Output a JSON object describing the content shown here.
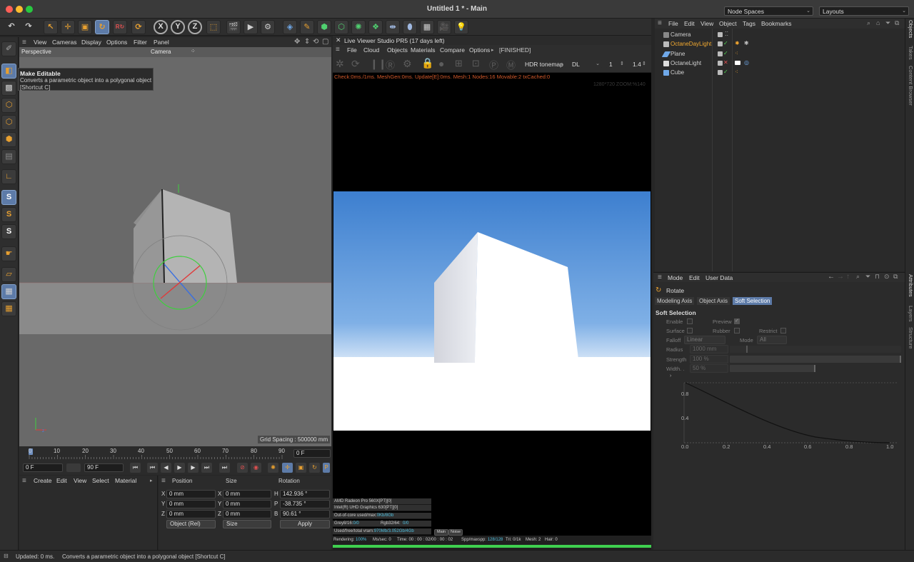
{
  "window": {
    "title": "Untitled 1 * - Main",
    "node_spaces": "Node Spaces",
    "layouts": "Layouts"
  },
  "viewport": {
    "menu": [
      "View",
      "Cameras",
      "Display",
      "Options",
      "Filter",
      "Panel"
    ],
    "projection": "Perspective",
    "camera": "Camera",
    "grid_spacing": "Grid Spacing : 500000 mm"
  },
  "tooltip": {
    "title": "Make Editable",
    "description": "Converts a parametric object into a polygonal object",
    "shortcut": "[Shortcut C]"
  },
  "timeline": {
    "ticks": [
      "0",
      "10",
      "20",
      "30",
      "40",
      "50",
      "60",
      "70",
      "80",
      "90"
    ],
    "current_frame": "0 F",
    "start_frame": "0 F",
    "end_frame": "90 F",
    "playhead_fraction": 0
  },
  "material_panel": {
    "menu": [
      "Create",
      "Edit",
      "View",
      "Select",
      "Material"
    ]
  },
  "coordinates": {
    "headers": [
      "Position",
      "Size",
      "Rotation"
    ],
    "rows": [
      {
        "axis": "X",
        "pos": "0 mm",
        "size_axis": "X",
        "size": "0 mm",
        "rot_axis": "H",
        "rot": "142.936 °"
      },
      {
        "axis": "Y",
        "pos": "0 mm",
        "size_axis": "Y",
        "size": "0 mm",
        "rot_axis": "P",
        "rot": "-38.735 °"
      },
      {
        "axis": "Z",
        "pos": "0 mm",
        "size_axis": "Z",
        "size": "0 mm",
        "rot_axis": "B",
        "rot": "90.61 °"
      }
    ],
    "mode": "Object (Rel)",
    "size_mode": "Size",
    "apply": "Apply"
  },
  "live_viewer": {
    "title": "Live Viewer Studio PR5 (17 days left)",
    "menu": [
      "File",
      "Cloud",
      "Objects",
      "Materials",
      "Compare",
      "Options"
    ],
    "finished": "[FINISHED]",
    "tonemap": "HDR tonemap",
    "kernel": "DL",
    "value1": "1",
    "value2": "1.4",
    "check_line": "Check:0ms./1ms. MeshGen:0ms. Update[E]:0ms. Mesh:1 Nodes:16 Movable:2 txCached:0",
    "resolution": "1280*720 ZOOM:%140",
    "devices": [
      {
        "label": "AMD Radeon Pro 560X[PT][0]",
        "value": ""
      },
      {
        "label": "Intel(R) UHD Graphics 630[PT][0]",
        "value": ""
      },
      {
        "label": "Out-of-core used/max:",
        "value": "0Kb/8Gb"
      },
      {
        "label": "Grey8/16:",
        "value": "0/0"
      },
      {
        "label": "Used/free/total vram:",
        "value": "970Mb/3.052Gb/4Gb"
      }
    ],
    "rgb": "Rgb32/64:",
    "rgb_value": "0/0",
    "main_btn": "Main",
    "noise_btn": "Noise",
    "status": {
      "rendering": "Rendering:",
      "rendering_value": "100%",
      "mssec": "Ms/sec: 0",
      "time": "Time: 00 : 00 : 02/00 : 00 : 02",
      "spp": "Spp/maxspp:",
      "spp_value": "128/128",
      "tri": "Tri: 0/1k",
      "mesh": "Mesh: 2",
      "hair": "Hair: 0"
    },
    "progress": 1.0
  },
  "objects_panel": {
    "menu": [
      "File",
      "Edit",
      "View",
      "Object",
      "Tags",
      "Bookmarks"
    ],
    "items": [
      {
        "name": "Camera",
        "color": "#cfcfcf",
        "icon": "camera-icon"
      },
      {
        "name": "OctaneDayLight",
        "color": "#f0a830",
        "icon": "sun-light-icon"
      },
      {
        "name": "Plane",
        "color": "#cfcfcf",
        "icon": "plane-icon"
      },
      {
        "name": "OctaneLight",
        "color": "#cfcfcf",
        "icon": "light-icon"
      },
      {
        "name": "Cube",
        "color": "#cfcfcf",
        "icon": "cube-icon"
      }
    ]
  },
  "side_tabs": {
    "top": [
      "Objects",
      "Takes",
      "Content Browser"
    ],
    "bottom": [
      "Attributes",
      "Layers",
      "Structure"
    ]
  },
  "attributes": {
    "menu": [
      "Mode",
      "Edit",
      "User Data"
    ],
    "tool": "Rotate",
    "tabs": [
      "Modeling Axis",
      "Object Axis",
      "Soft Selection"
    ],
    "section": "Soft Selection",
    "enable": "Enable",
    "preview": "Preview",
    "surface": "Surface",
    "rubber": "Rubber",
    "restrict": "Restrict",
    "falloff": "Falloff",
    "falloff_value": "Linear",
    "mode": "Mode",
    "mode_value": "All",
    "radius": "Radius",
    "radius_value": "1000 mm",
    "strength": "Strength",
    "strength_value": "100 %",
    "width": "Width. .",
    "width_value": "50 %",
    "curve_x_ticks": [
      "0.0",
      "0.2",
      "0.4",
      "0.6",
      "0.8",
      "1.0"
    ],
    "curve_y_ticks": [
      "0.8",
      "0.4"
    ]
  },
  "statusbar": {
    "text1": "Updated: 0 ms.",
    "text2": "Converts a parametric object into a polygonal object [Shortcut C]"
  }
}
